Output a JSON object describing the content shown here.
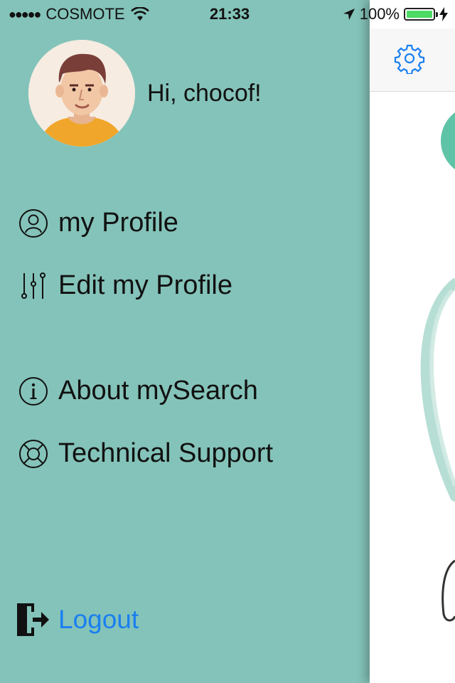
{
  "status_bar": {
    "signal": "●●●●●",
    "carrier": "COSMOTE",
    "time": "21:33",
    "battery_percent": "100%",
    "battery_level": 1.0
  },
  "profile": {
    "greeting": "Hi, chocof!"
  },
  "menu": {
    "my_profile": "my Profile",
    "edit_profile": "Edit my Profile",
    "about": "About mySearch",
    "support": "Technical Support",
    "logout": "Logout"
  },
  "colors": {
    "drawer_bg": "#84c3b9",
    "link_blue": "#1a7ff0",
    "battery_green": "#4cd964"
  }
}
